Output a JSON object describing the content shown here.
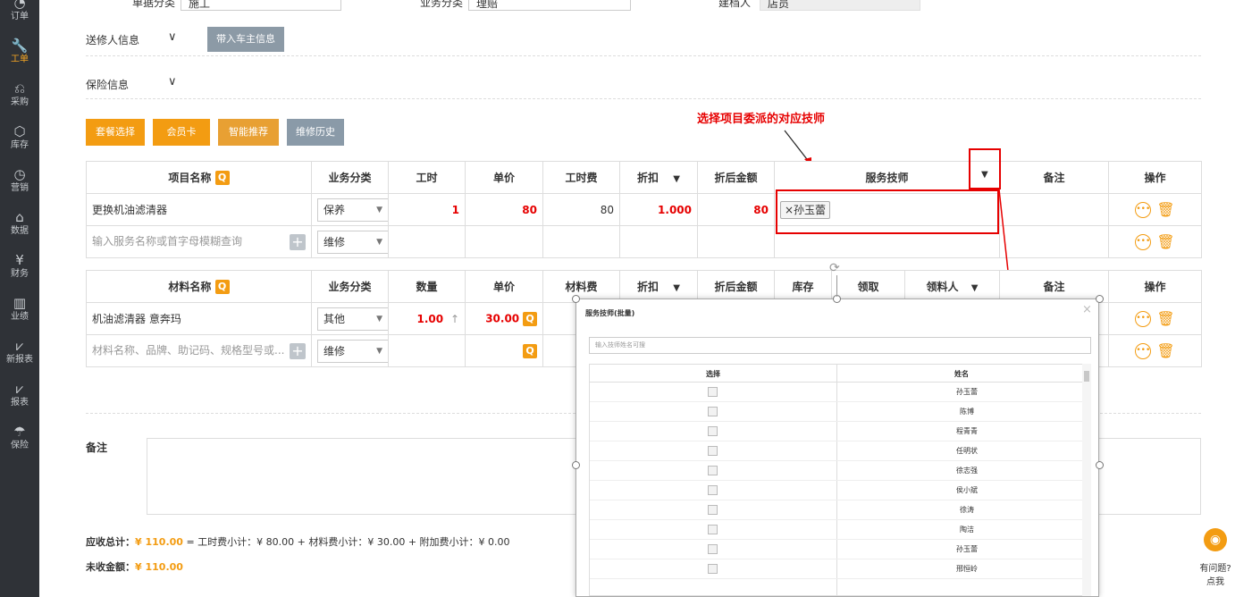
{
  "nav": [
    {
      "label": "订单",
      "icon": "order-icon",
      "glyph": "◔"
    },
    {
      "label": "工单",
      "icon": "wrench-icon",
      "glyph": "🔧"
    },
    {
      "label": "采购",
      "icon": "cart-icon",
      "glyph": "⎌"
    },
    {
      "label": "库存",
      "icon": "cube-icon",
      "glyph": "⬡"
    },
    {
      "label": "营销",
      "icon": "megaphone-icon",
      "glyph": "◷"
    },
    {
      "label": "数据",
      "icon": "data-icon",
      "glyph": "⌂"
    },
    {
      "label": "财务",
      "icon": "yen-icon",
      "glyph": "¥"
    },
    {
      "label": "业绩",
      "icon": "bar-chart-icon",
      "glyph": "▥"
    },
    {
      "label": "新报表",
      "icon": "line-chart-icon",
      "glyph": "⩗"
    },
    {
      "label": "报表",
      "icon": "report-icon",
      "glyph": "⩗"
    },
    {
      "label": "保险",
      "icon": "umbrella-icon",
      "glyph": "☂"
    }
  ],
  "top": {
    "label1": "单据分类",
    "value1": "施工",
    "label2": "业务分类",
    "value2": "理赔",
    "label3": "建档人",
    "value3": "店员"
  },
  "sections": {
    "sender": "送修人信息",
    "bring_owner": "带入车主信息",
    "insurance": "保险信息"
  },
  "annotation": "选择项目委派的对应技师",
  "buttons": [
    "套餐选择",
    "会员卡",
    "智能推荐",
    "维修历史"
  ],
  "service_table": {
    "headers": [
      "项目名称",
      "业务分类",
      "工时",
      "单价",
      "工时费",
      "折扣",
      "折后金额",
      "服务技师",
      "备注",
      "操作"
    ],
    "row": {
      "name": "更换机油滤清器",
      "category": "保养",
      "hours": "1",
      "price": "80",
      "fee": "80",
      "discount": "1.000",
      "amount": "80",
      "tech_tag": "×孙玉蕾"
    },
    "input_placeholder": "输入服务名称或首字母模糊查询",
    "input_category": "维修"
  },
  "material_table": {
    "headers": [
      "材料名称",
      "业务分类",
      "数量",
      "单价",
      "材料费",
      "折扣",
      "折后金额",
      "库存",
      "领取",
      "领料人",
      "备注",
      "操作"
    ],
    "row": {
      "name": "机油滤清器 意奔玛",
      "category": "其他",
      "qty": "1.00",
      "arrow": "↑",
      "price": "30.00"
    },
    "input_placeholder": "材料名称、品牌、助记码、规格型号或...",
    "input_category": "维修"
  },
  "remark_label": "备注",
  "totals": {
    "line1_label": "应收总计：",
    "line1_value": "¥ 110.00",
    "line1_detail": "= 工时费小计：¥ 80.00 + 材料费小计：¥ 30.00 + 附加费小计：¥ 0.00",
    "line2_label": "未收金额：",
    "line2_value": "¥ 110.00"
  },
  "modal": {
    "title": "服务技师(批量)",
    "search_placeholder": "输入技师姓名可搜",
    "col_select": "选择",
    "col_name": "姓名",
    "technicians": [
      "孙玉蕾",
      "陈博",
      "程青青",
      "任明状",
      "徐志强",
      "侯小斌",
      "徐涛",
      "陶洁",
      "孙玉蕾",
      "邢恒岭"
    ]
  },
  "help": {
    "line1": "有问题?",
    "line2": "点我"
  },
  "colors": {
    "accent": "#f39c12",
    "sidebar": "#2f3237",
    "red": "#e60000"
  }
}
